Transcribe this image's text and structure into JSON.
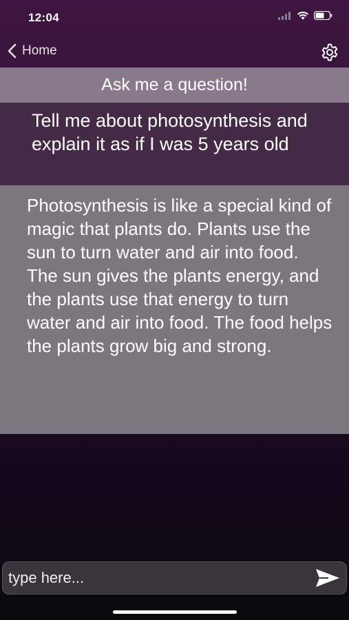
{
  "status_bar": {
    "time": "12:04",
    "icons": [
      "cellular-signal-icon",
      "wifi-icon",
      "battery-icon"
    ]
  },
  "nav": {
    "back_label": "Home",
    "back_icon": "chevron-left-icon",
    "settings_icon": "gear-icon"
  },
  "header": {
    "title": "Ask me a question!"
  },
  "conversation": {
    "user_message": "Tell me about photosynthesis and explain it as if I was 5 years old",
    "bot_message": "Photosynthesis is like a special kind of magic that plants do. Plants use the sun to turn water and air into food. The sun gives the plants energy, and the plants use that energy to turn water and air into food. The food helps the plants grow big and strong."
  },
  "input": {
    "placeholder": "type here...",
    "value": "",
    "send_icon": "send-arrow-icon"
  },
  "colors": {
    "background_top": "#3d1640",
    "header_banner": "#897a8b",
    "user_bubble": "#452a48",
    "bot_bubble": "#7d767f",
    "input_background": "#39353b"
  }
}
